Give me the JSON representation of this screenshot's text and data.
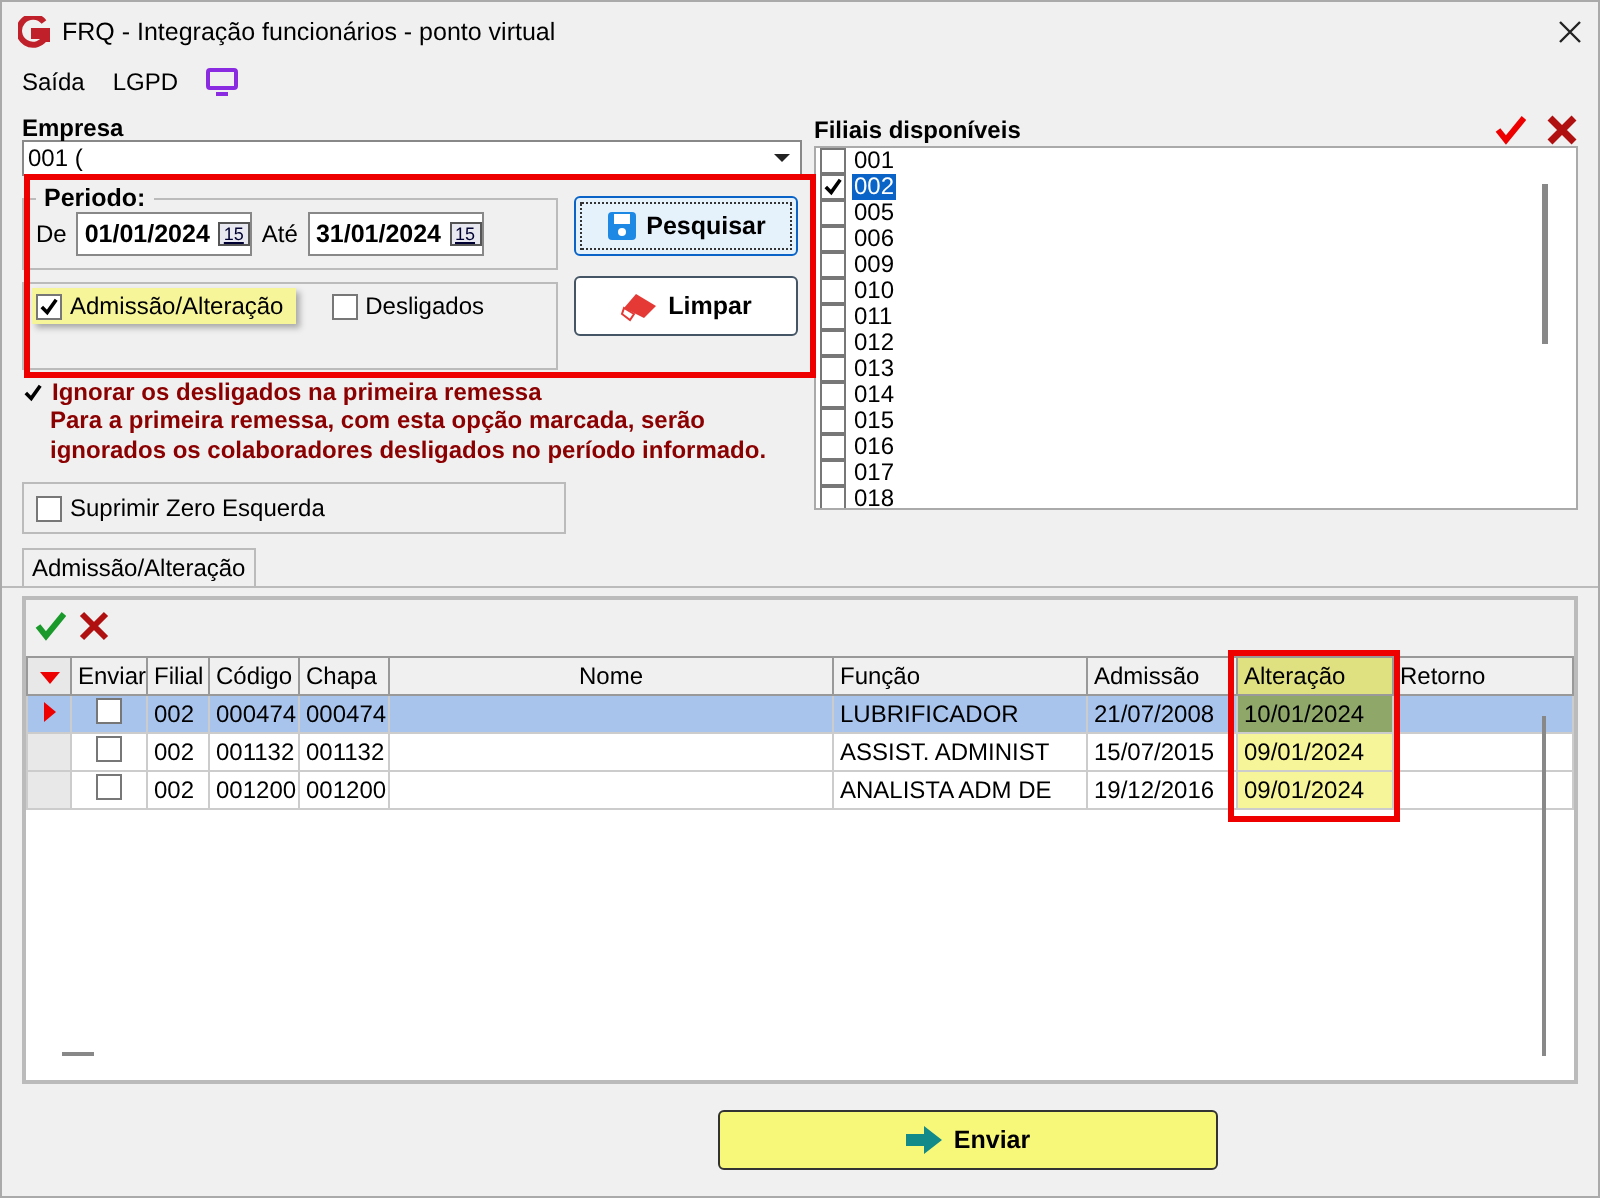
{
  "window": {
    "title": "FRQ - Integração funcionários - ponto virtual"
  },
  "menu": [
    "Saída",
    "LGPD"
  ],
  "empresa": {
    "label": "Empresa",
    "value": "001 ("
  },
  "periodo": {
    "label": "Periodo:",
    "from_label": "De",
    "from": "01/01/2024",
    "to_label": "Até",
    "to": "31/01/2024",
    "from_calendar": "15",
    "to_calendar": "15"
  },
  "options": [
    {
      "label": "Admissão/Alteração",
      "checked": true,
      "highlighted": true
    },
    {
      "label": "Desligados",
      "checked": false,
      "highlighted": false
    }
  ],
  "buttons": [
    {
      "kind": "search",
      "label": "Pesquisar"
    },
    {
      "kind": "clear",
      "label": "Limpar"
    }
  ],
  "ignore": {
    "checked": true,
    "label": "Ignorar os desligados na primeira remessa",
    "note": "Para a primeira remessa, com esta opção marcada, serão ignorados os colaboradores desligados no período informado."
  },
  "suprimir": {
    "checked": false,
    "label": "Suprimir Zero Esquerda"
  },
  "filiais": {
    "title": "Filiais disponíveis",
    "items": [
      {
        "label": "001",
        "checked": false,
        "selected": false
      },
      {
        "label": "002",
        "checked": true,
        "selected": true
      },
      {
        "label": "005",
        "checked": false,
        "selected": false
      },
      {
        "label": "006",
        "checked": false,
        "selected": false
      },
      {
        "label": "009",
        "checked": false,
        "selected": false
      },
      {
        "label": "010",
        "checked": false,
        "selected": false
      },
      {
        "label": "011",
        "checked": false,
        "selected": false
      },
      {
        "label": "012",
        "checked": false,
        "selected": false
      },
      {
        "label": "013",
        "checked": false,
        "selected": false
      },
      {
        "label": "014",
        "checked": false,
        "selected": false
      },
      {
        "label": "015",
        "checked": false,
        "selected": false
      },
      {
        "label": "016",
        "checked": false,
        "selected": false
      },
      {
        "label": "017",
        "checked": false,
        "selected": false
      },
      {
        "label": "018",
        "checked": false,
        "selected": false
      }
    ]
  },
  "tabs": [
    {
      "label": "Admissão/Alteração",
      "selected": true
    }
  ],
  "table": {
    "columns": [
      {
        "label": "Enviar",
        "highlighted": false
      },
      {
        "label": "Filial",
        "highlighted": false
      },
      {
        "label": "Código",
        "highlighted": false
      },
      {
        "label": "Chapa",
        "highlighted": false
      },
      {
        "label": "Nome",
        "highlighted": false
      },
      {
        "label": "Função",
        "highlighted": false
      },
      {
        "label": "Admissão",
        "highlighted": false
      },
      {
        "label": "Alteração",
        "highlighted": true
      },
      {
        "label": "Retorno",
        "highlighted": false
      }
    ],
    "rows": [
      {
        "selected": true,
        "enviar": false,
        "cells": [
          "",
          "002",
          "000474",
          "000474",
          "",
          "LUBRIFICADOR",
          "21/07/2008",
          "10/01/2024",
          ""
        ]
      },
      {
        "selected": false,
        "enviar": false,
        "cells": [
          "",
          "002",
          "001132",
          "001132",
          "",
          "ASSIST. ADMINIST",
          "15/07/2015",
          "09/01/2024",
          ""
        ]
      },
      {
        "selected": false,
        "enviar": false,
        "cells": [
          "",
          "002",
          "001200",
          "001200",
          "",
          "ANALISTA ADM DE",
          "19/12/2016",
          "09/01/2024",
          ""
        ]
      }
    ]
  },
  "send_button": "Enviar"
}
